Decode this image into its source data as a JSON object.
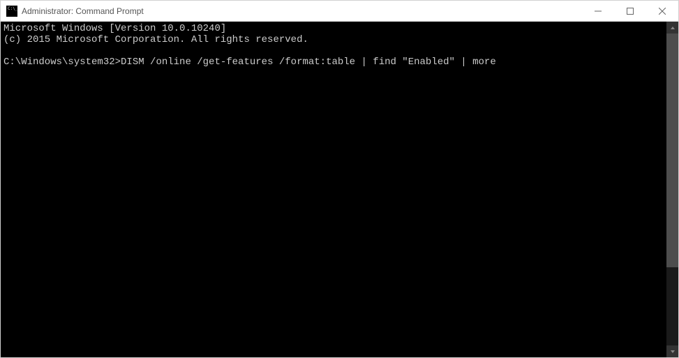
{
  "titlebar": {
    "title": "Administrator: Command Prompt"
  },
  "console": {
    "line1": "Microsoft Windows [Version 10.0.10240]",
    "line2": "(c) 2015 Microsoft Corporation. All rights reserved.",
    "blank": "",
    "prompt": "C:\\Windows\\system32>",
    "command": "DISM /online /get-features /format:table | find \"Enabled\" | more"
  }
}
